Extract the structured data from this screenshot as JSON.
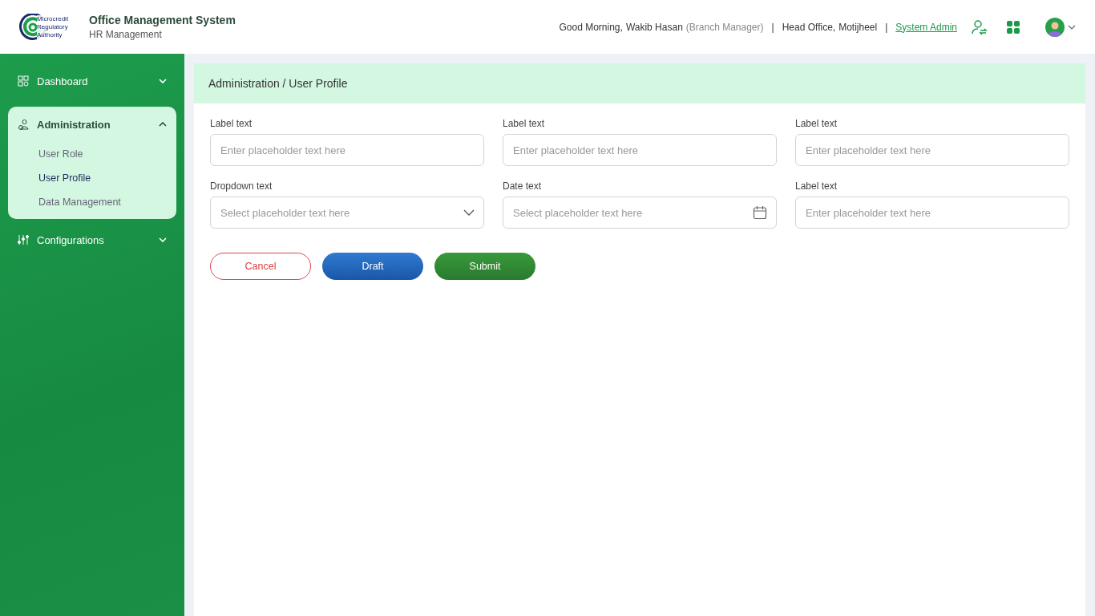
{
  "header": {
    "logo_lines": [
      "Microcredit",
      "Regulatory",
      "Authority"
    ],
    "title": "Office Management System",
    "subtitle": "HR Management",
    "greeting": "Good Morning,",
    "user_name": "Wakib Hasan",
    "user_role": "(Branch Manager)",
    "separator_1": "|",
    "office": "Head Office,",
    "location": "Motijheel",
    "separator_2": "|",
    "role_link": "System Admin"
  },
  "sidebar": {
    "items": [
      {
        "label": "Dashboard",
        "expanded": false
      },
      {
        "label": "Administration",
        "expanded": true,
        "children": [
          {
            "label": "User Role",
            "selected": false
          },
          {
            "label": "User Profile",
            "selected": true
          },
          {
            "label": "Data Management",
            "selected": false
          }
        ]
      },
      {
        "label": "Configurations",
        "expanded": false
      }
    ]
  },
  "breadcrumb": "Administration / User Profile",
  "fields": [
    {
      "kind": "text",
      "label": "Label text",
      "placeholder": "Enter placeholder text here"
    },
    {
      "kind": "text",
      "label": "Label text",
      "placeholder": "Enter placeholder text here"
    },
    {
      "kind": "text",
      "label": "Label text",
      "placeholder": "Enter placeholder text here"
    },
    {
      "kind": "dropdown",
      "label": "Dropdown text",
      "placeholder": "Select placeholder text here"
    },
    {
      "kind": "date",
      "label": "Date text",
      "placeholder": "Select placeholder text here"
    },
    {
      "kind": "text",
      "label": "Label text",
      "placeholder": "Enter placeholder text here"
    }
  ],
  "buttons": [
    {
      "kind": "cancel",
      "label": "Cancel"
    },
    {
      "kind": "draft",
      "label": "Draft"
    },
    {
      "kind": "submit",
      "label": "Submit"
    }
  ]
}
